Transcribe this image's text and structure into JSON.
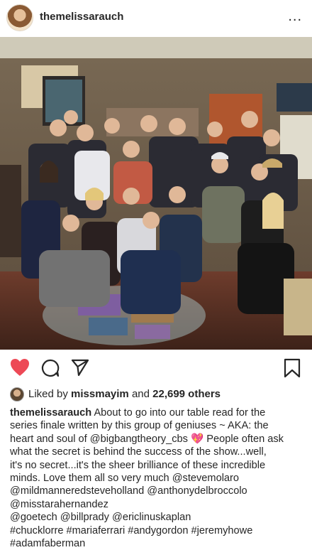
{
  "header": {
    "username": "themelissarauch",
    "more_label": "..."
  },
  "icons": {
    "like": "heart-icon",
    "comment": "comment-icon",
    "share": "send-icon",
    "save": "bookmark-icon",
    "like_color": "#ed4956"
  },
  "likes": {
    "prefix": "Liked by",
    "user": "missmayim",
    "middle": "and",
    "others": "22,699 others"
  },
  "caption": {
    "author": "themelissarauch",
    "line1_rest": "About to go into our table read for the",
    "line2": "series finale written by this group of geniuses ~ AKA: the",
    "line3_pre": "heart and soul of",
    "line3_mention": "@bigbangtheory_cbs",
    "line3_emoji": "💖",
    "line3_post": "People often ask",
    "line4": "what the secret is behind the success of the show...well,",
    "line5": "it's no secret...it's the sheer brilliance of these incredible",
    "line6": "minds. Love them all so very much @stevemolaro",
    "line7": "@mildmanneredsteveholland @anthonydelbroccolo",
    "line8": "@misstarahernandez",
    "line9": "@goetech @billprady @ericlinuskaplan",
    "line10": "#chucklorre #mariaferrari #andygordon #jeremyhowe",
    "line11": "#adamfaberman"
  }
}
